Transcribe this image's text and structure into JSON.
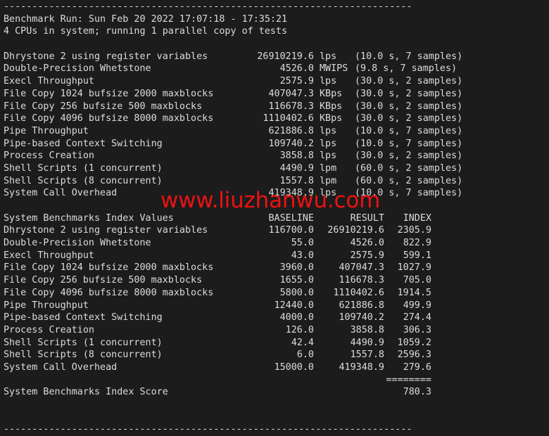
{
  "terminal": {
    "background_color": "#1c1c1c",
    "text_color": "#dcdcdc",
    "separator_top": "------------------------------------------------------------------------",
    "separator_bottom": "------------------------------------------------------------------------",
    "header": {
      "benchmark_run": "Benchmark Run: Sun Feb 20 2022 17:07:18 - 17:35:21",
      "cpu_line": "4 CPUs in system; running 1 parallel copy of tests"
    },
    "results": {
      "rows": [
        {
          "name": "Dhrystone 2 using register variables",
          "value": "26910219.6",
          "unit": "lps",
          "timing": "(10.0 s, 7 samples)"
        },
        {
          "name": "Double-Precision Whetstone",
          "value": "4526.0",
          "unit": "MWIPS",
          "timing": "(9.8 s, 7 samples)"
        },
        {
          "name": "Execl Throughput",
          "value": "2575.9",
          "unit": "lps",
          "timing": "(30.0 s, 2 samples)"
        },
        {
          "name": "File Copy 1024 bufsize 2000 maxblocks",
          "value": "407047.3",
          "unit": "KBps",
          "timing": "(30.0 s, 2 samples)"
        },
        {
          "name": "File Copy 256 bufsize 500 maxblocks",
          "value": "116678.3",
          "unit": "KBps",
          "timing": "(30.0 s, 2 samples)"
        },
        {
          "name": "File Copy 4096 bufsize 8000 maxblocks",
          "value": "1110402.6",
          "unit": "KBps",
          "timing": "(30.0 s, 2 samples)"
        },
        {
          "name": "Pipe Throughput",
          "value": "621886.8",
          "unit": "lps",
          "timing": "(10.0 s, 7 samples)"
        },
        {
          "name": "Pipe-based Context Switching",
          "value": "109740.2",
          "unit": "lps",
          "timing": "(10.0 s, 7 samples)"
        },
        {
          "name": "Process Creation",
          "value": "3858.8",
          "unit": "lps",
          "timing": "(30.0 s, 2 samples)"
        },
        {
          "name": "Shell Scripts (1 concurrent)",
          "value": "4490.9",
          "unit": "lpm",
          "timing": "(60.0 s, 2 samples)"
        },
        {
          "name": "Shell Scripts (8 concurrent)",
          "value": "1557.8",
          "unit": "lpm",
          "timing": "(60.0 s, 2 samples)"
        },
        {
          "name": "System Call Overhead",
          "value": "419348.9",
          "unit": "lps",
          "timing": "(10.0 s, 7 samples)"
        }
      ]
    },
    "index_table": {
      "title": "System Benchmarks Index Values",
      "columns": [
        "BASELINE",
        "RESULT",
        "INDEX"
      ],
      "rows": [
        {
          "name": "Dhrystone 2 using register variables",
          "baseline": "116700.0",
          "result": "26910219.6",
          "index": "2305.9"
        },
        {
          "name": "Double-Precision Whetstone",
          "baseline": "55.0",
          "result": "4526.0",
          "index": "822.9"
        },
        {
          "name": "Execl Throughput",
          "baseline": "43.0",
          "result": "2575.9",
          "index": "599.1"
        },
        {
          "name": "File Copy 1024 bufsize 2000 maxblocks",
          "baseline": "3960.0",
          "result": "407047.3",
          "index": "1027.9"
        },
        {
          "name": "File Copy 256 bufsize 500 maxblocks",
          "baseline": "1655.0",
          "result": "116678.3",
          "index": "705.0"
        },
        {
          "name": "File Copy 4096 bufsize 8000 maxblocks",
          "baseline": "5800.0",
          "result": "1110402.6",
          "index": "1914.5"
        },
        {
          "name": "Pipe Throughput",
          "baseline": "12440.0",
          "result": "621886.8",
          "index": "499.9"
        },
        {
          "name": "Pipe-based Context Switching",
          "baseline": "4000.0",
          "result": "109740.2",
          "index": "274.4"
        },
        {
          "name": "Process Creation",
          "baseline": "126.0",
          "result": "3858.8",
          "index": "306.3"
        },
        {
          "name": "Shell Scripts (1 concurrent)",
          "baseline": "42.4",
          "result": "4490.9",
          "index": "1059.2"
        },
        {
          "name": "Shell Scripts (8 concurrent)",
          "baseline": "6.0",
          "result": "1557.8",
          "index": "2596.3"
        },
        {
          "name": "System Call Overhead",
          "baseline": "15000.0",
          "result": "419348.9",
          "index": "279.6"
        }
      ],
      "equals_rule": "========",
      "score_label": "System Benchmarks Index Score",
      "score_value": "780.3"
    },
    "watermark": {
      "text": "www.liuzhanwu.com",
      "color": "#ee1111"
    }
  }
}
